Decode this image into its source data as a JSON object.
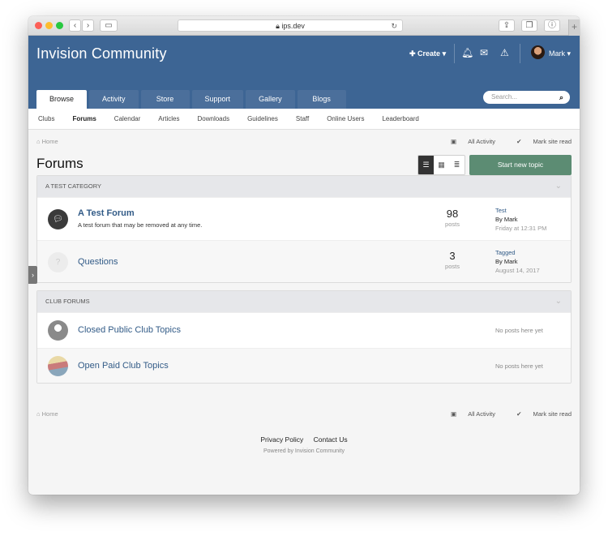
{
  "browser": {
    "url": "ips.dev"
  },
  "header": {
    "brand": "Invision Community",
    "create_label": "Create",
    "user_name": "Mark",
    "search_placeholder": "Search..."
  },
  "tabs": [
    {
      "label": "Browse",
      "active": true
    },
    {
      "label": "Activity"
    },
    {
      "label": "Store"
    },
    {
      "label": "Support"
    },
    {
      "label": "Gallery"
    },
    {
      "label": "Blogs"
    }
  ],
  "subnav": [
    {
      "label": "Clubs"
    },
    {
      "label": "Forums",
      "active": true
    },
    {
      "label": "Calendar"
    },
    {
      "label": "Articles"
    },
    {
      "label": "Downloads"
    },
    {
      "label": "Guidelines"
    },
    {
      "label": "Staff"
    },
    {
      "label": "Online Users"
    },
    {
      "label": "Leaderboard"
    }
  ],
  "breadcrumb": {
    "home": "Home",
    "all_activity": "All Activity",
    "mark_read": "Mark site read"
  },
  "page": {
    "title": "Forums",
    "new_topic_label": "Start new topic"
  },
  "categories": [
    {
      "title": "A TEST CATEGORY",
      "forums": [
        {
          "name": "A Test Forum",
          "description": "A test forum that may be removed at any time.",
          "count": "98",
          "count_label": "posts",
          "last_title": "Test",
          "last_by": "By Mark",
          "last_date": "Friday at 12:31 PM"
        },
        {
          "name": "Questions",
          "count": "3",
          "count_label": "posts",
          "last_title": "Tagged",
          "last_by": "By Mark",
          "last_date": "August 14, 2017"
        }
      ]
    },
    {
      "title": "CLUB FORUMS",
      "forums": [
        {
          "name": "Closed Public Club Topics",
          "no_posts": "No posts here yet"
        },
        {
          "name": "Open Paid Club Topics",
          "no_posts": "No posts here yet"
        }
      ]
    }
  ],
  "footer": {
    "privacy": "Privacy Policy",
    "contact": "Contact Us",
    "powered": "Powered by Invision Community"
  },
  "colors": {
    "header": "#3d6594",
    "link": "#325b87",
    "button": "#5c8c73"
  }
}
